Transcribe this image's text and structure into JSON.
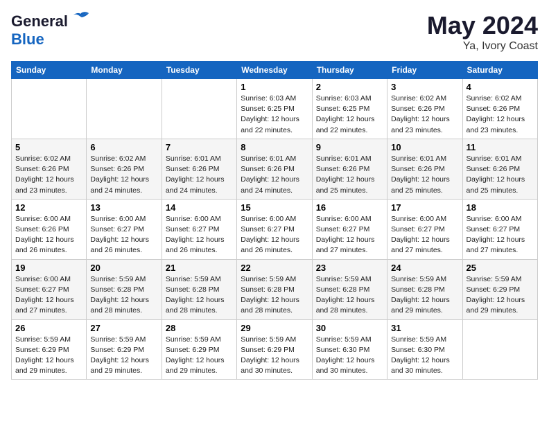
{
  "header": {
    "logo_line1": "General",
    "logo_line2": "Blue",
    "month_year": "May 2024",
    "location": "Ya, Ivory Coast"
  },
  "days_of_week": [
    "Sunday",
    "Monday",
    "Tuesday",
    "Wednesday",
    "Thursday",
    "Friday",
    "Saturday"
  ],
  "weeks": [
    [
      {
        "day": "",
        "info": ""
      },
      {
        "day": "",
        "info": ""
      },
      {
        "day": "",
        "info": ""
      },
      {
        "day": "1",
        "info": "Sunrise: 6:03 AM\nSunset: 6:25 PM\nDaylight: 12 hours\nand 22 minutes."
      },
      {
        "day": "2",
        "info": "Sunrise: 6:03 AM\nSunset: 6:25 PM\nDaylight: 12 hours\nand 22 minutes."
      },
      {
        "day": "3",
        "info": "Sunrise: 6:02 AM\nSunset: 6:26 PM\nDaylight: 12 hours\nand 23 minutes."
      },
      {
        "day": "4",
        "info": "Sunrise: 6:02 AM\nSunset: 6:26 PM\nDaylight: 12 hours\nand 23 minutes."
      }
    ],
    [
      {
        "day": "5",
        "info": "Sunrise: 6:02 AM\nSunset: 6:26 PM\nDaylight: 12 hours\nand 23 minutes."
      },
      {
        "day": "6",
        "info": "Sunrise: 6:02 AM\nSunset: 6:26 PM\nDaylight: 12 hours\nand 24 minutes."
      },
      {
        "day": "7",
        "info": "Sunrise: 6:01 AM\nSunset: 6:26 PM\nDaylight: 12 hours\nand 24 minutes."
      },
      {
        "day": "8",
        "info": "Sunrise: 6:01 AM\nSunset: 6:26 PM\nDaylight: 12 hours\nand 24 minutes."
      },
      {
        "day": "9",
        "info": "Sunrise: 6:01 AM\nSunset: 6:26 PM\nDaylight: 12 hours\nand 25 minutes."
      },
      {
        "day": "10",
        "info": "Sunrise: 6:01 AM\nSunset: 6:26 PM\nDaylight: 12 hours\nand 25 minutes."
      },
      {
        "day": "11",
        "info": "Sunrise: 6:01 AM\nSunset: 6:26 PM\nDaylight: 12 hours\nand 25 minutes."
      }
    ],
    [
      {
        "day": "12",
        "info": "Sunrise: 6:00 AM\nSunset: 6:26 PM\nDaylight: 12 hours\nand 26 minutes."
      },
      {
        "day": "13",
        "info": "Sunrise: 6:00 AM\nSunset: 6:27 PM\nDaylight: 12 hours\nand 26 minutes."
      },
      {
        "day": "14",
        "info": "Sunrise: 6:00 AM\nSunset: 6:27 PM\nDaylight: 12 hours\nand 26 minutes."
      },
      {
        "day": "15",
        "info": "Sunrise: 6:00 AM\nSunset: 6:27 PM\nDaylight: 12 hours\nand 26 minutes."
      },
      {
        "day": "16",
        "info": "Sunrise: 6:00 AM\nSunset: 6:27 PM\nDaylight: 12 hours\nand 27 minutes."
      },
      {
        "day": "17",
        "info": "Sunrise: 6:00 AM\nSunset: 6:27 PM\nDaylight: 12 hours\nand 27 minutes."
      },
      {
        "day": "18",
        "info": "Sunrise: 6:00 AM\nSunset: 6:27 PM\nDaylight: 12 hours\nand 27 minutes."
      }
    ],
    [
      {
        "day": "19",
        "info": "Sunrise: 6:00 AM\nSunset: 6:27 PM\nDaylight: 12 hours\nand 27 minutes."
      },
      {
        "day": "20",
        "info": "Sunrise: 5:59 AM\nSunset: 6:28 PM\nDaylight: 12 hours\nand 28 minutes."
      },
      {
        "day": "21",
        "info": "Sunrise: 5:59 AM\nSunset: 6:28 PM\nDaylight: 12 hours\nand 28 minutes."
      },
      {
        "day": "22",
        "info": "Sunrise: 5:59 AM\nSunset: 6:28 PM\nDaylight: 12 hours\nand 28 minutes."
      },
      {
        "day": "23",
        "info": "Sunrise: 5:59 AM\nSunset: 6:28 PM\nDaylight: 12 hours\nand 28 minutes."
      },
      {
        "day": "24",
        "info": "Sunrise: 5:59 AM\nSunset: 6:28 PM\nDaylight: 12 hours\nand 29 minutes."
      },
      {
        "day": "25",
        "info": "Sunrise: 5:59 AM\nSunset: 6:29 PM\nDaylight: 12 hours\nand 29 minutes."
      }
    ],
    [
      {
        "day": "26",
        "info": "Sunrise: 5:59 AM\nSunset: 6:29 PM\nDaylight: 12 hours\nand 29 minutes."
      },
      {
        "day": "27",
        "info": "Sunrise: 5:59 AM\nSunset: 6:29 PM\nDaylight: 12 hours\nand 29 minutes."
      },
      {
        "day": "28",
        "info": "Sunrise: 5:59 AM\nSunset: 6:29 PM\nDaylight: 12 hours\nand 29 minutes."
      },
      {
        "day": "29",
        "info": "Sunrise: 5:59 AM\nSunset: 6:29 PM\nDaylight: 12 hours\nand 30 minutes."
      },
      {
        "day": "30",
        "info": "Sunrise: 5:59 AM\nSunset: 6:30 PM\nDaylight: 12 hours\nand 30 minutes."
      },
      {
        "day": "31",
        "info": "Sunrise: 5:59 AM\nSunset: 6:30 PM\nDaylight: 12 hours\nand 30 minutes."
      },
      {
        "day": "",
        "info": ""
      }
    ]
  ]
}
